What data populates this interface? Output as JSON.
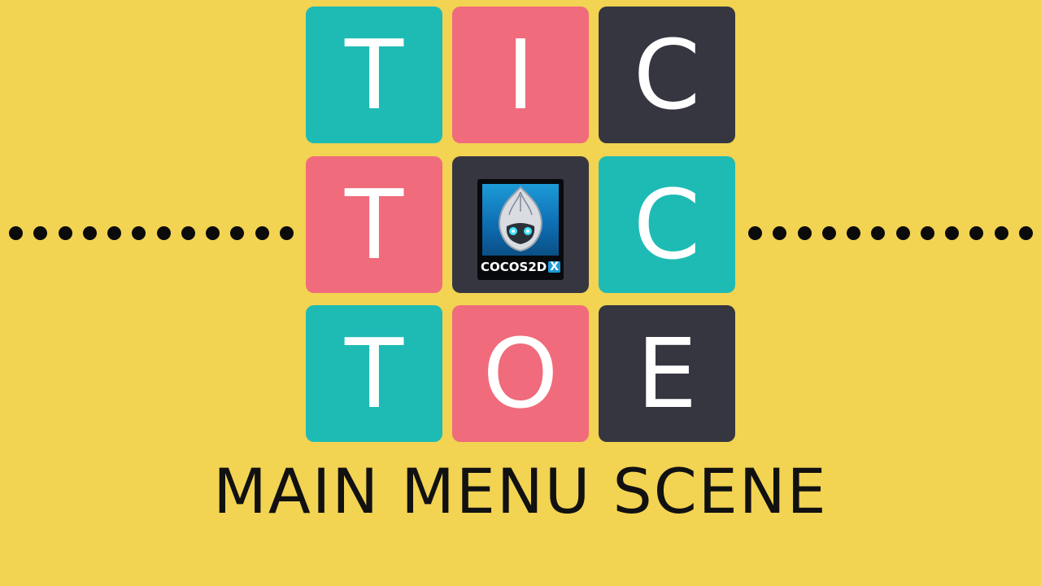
{
  "board": {
    "tiles": [
      {
        "letter": "T",
        "color": "#1ebbb5"
      },
      {
        "letter": "I",
        "color": "#f06b7c"
      },
      {
        "letter": "C",
        "color": "#363641"
      },
      {
        "letter": "T",
        "color": "#f06b7c"
      },
      {
        "letter": "",
        "color": "#363641",
        "logo": "cocos2dx-logo"
      },
      {
        "letter": "C",
        "color": "#1ebbb5"
      },
      {
        "letter": "T",
        "color": "#1ebbb5"
      },
      {
        "letter": "O",
        "color": "#f06b7c"
      },
      {
        "letter": "E",
        "color": "#363641"
      }
    ]
  },
  "logo": {
    "text_main": "COCOS",
    "text_suffix": "2D",
    "text_badge": "X",
    "icon": "cocos-flame-mascot-icon"
  },
  "title": "MAIN MENU SCENE",
  "colors": {
    "background": "#f2d352",
    "teal": "#1ebbb5",
    "pink": "#f06b7c",
    "dark": "#363641",
    "dots": "#0b0b0b"
  }
}
